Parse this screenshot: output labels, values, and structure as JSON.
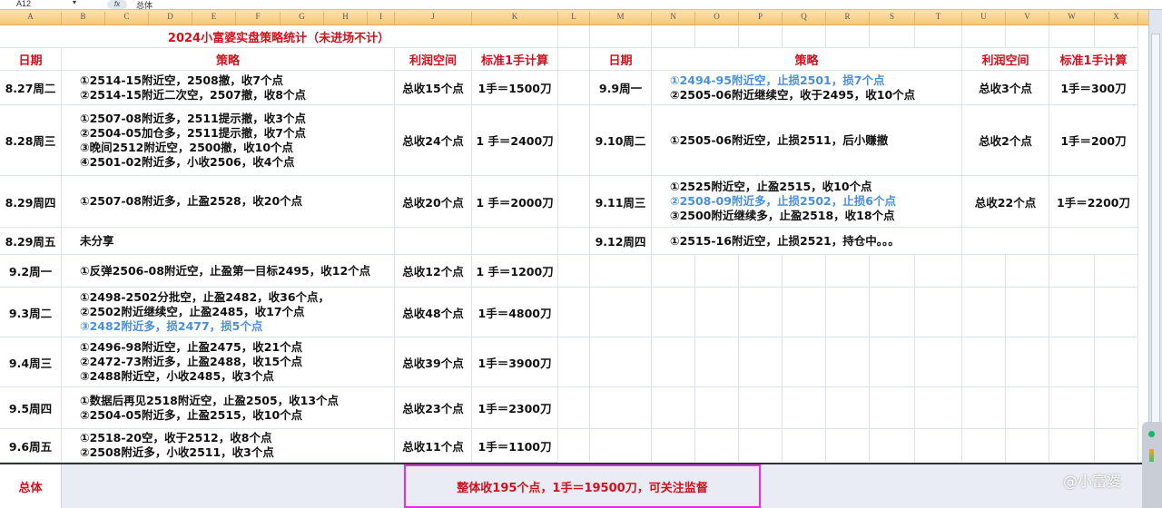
{
  "formula_bar": {
    "name_box": "A12",
    "fx": "fx",
    "value": "总体"
  },
  "columns": [
    "A",
    "B",
    "C",
    "D",
    "E",
    "F",
    "G",
    "H",
    "I",
    "J",
    "K",
    "L",
    "M",
    "N",
    "O",
    "P",
    "Q",
    "R",
    "S",
    "T",
    "U",
    "V",
    "W",
    "X"
  ],
  "title": "2024小富婆实盘策略统计（未进场不计）",
  "headers": {
    "date": "日期",
    "strategy": "策略",
    "profit": "利润空间",
    "calc": "标准1手计算"
  },
  "left_rows": [
    {
      "date": "8.27周二",
      "lines": [
        {
          "text": "①2514-15附近空，2508撤，收7个点"
        },
        {
          "text": "②2514-15附近二次空，2507撤，收8个点"
        }
      ],
      "profit": "总收15个点",
      "calc": "1手＝1500刀"
    },
    {
      "date": "8.28周三",
      "lines": [
        {
          "text": "①2507-08附近多，2511提示撤，收3个点"
        },
        {
          "text": "②2504-05加仓多，2511提示撤，收7个点"
        },
        {
          "text": "③晚间2512附近空，2500撤，收10个点"
        },
        {
          "text": "④2501-02附近多，小收2506，收4个点"
        }
      ],
      "profit": "总收24个点",
      "calc": "1 手＝2400刀"
    },
    {
      "date": "8.29周四",
      "lines": [
        {
          "text": "①2507-08附近多，止盈2528，收20个点"
        }
      ],
      "profit": "总收20个点",
      "calc": "1 手＝2000刀"
    },
    {
      "date": "8.29周五",
      "lines": [
        {
          "text": "未分享"
        }
      ],
      "profit": "",
      "calc": ""
    },
    {
      "date": "9.2周一",
      "lines": [
        {
          "text": "①反弹2506-08附近空，止盈第一目标2495，收12个点"
        }
      ],
      "profit": "总收12个点",
      "calc": "1 手＝1200刀"
    },
    {
      "date": "9.3周二",
      "lines": [
        {
          "text": "①2498-2502分批空，止盈2482，收36个点，"
        },
        {
          "text": "②2502附近继续空，止盈2485，收17个点"
        },
        {
          "text": "③2482附近多，损2477，损5个点",
          "loss": true
        }
      ],
      "profit": "总收48个点",
      "calc": "1手＝4800刀"
    },
    {
      "date": "9.4周三",
      "lines": [
        {
          "text": "①2496-98附近空，止盈2475，收21个点"
        },
        {
          "text": "②2472-73附近多，止盈2488，收15个点"
        },
        {
          "text": "③2488附近空，小收2485，收3个点"
        }
      ],
      "profit": "总收39个点",
      "calc": "1手＝3900刀"
    },
    {
      "date": "9.5周四",
      "lines": [
        {
          "text": "①数据后再见2518附近空，止盈2505，收13个点"
        },
        {
          "text": "②2504-05附近多，止盈2515，收10个点"
        }
      ],
      "profit": "总收23个点",
      "calc": "1手＝2300刀"
    },
    {
      "date": "9.6周五",
      "lines": [
        {
          "text": "①2518-20空，收于2512，收8个点"
        },
        {
          "text": "②2508附近多，小收2511，收3个点"
        }
      ],
      "profit": "总收11个点",
      "calc": "1手＝1100刀"
    }
  ],
  "right_rows": [
    {
      "date": "9.9周一",
      "lines": [
        {
          "text": "①2494-95附近空，止损2501，损7个点",
          "loss": true
        },
        {
          "text": "②2505-06附近继续空，收于2495，收10个点"
        }
      ],
      "profit": "总收3个点",
      "calc": "1手＝300刀"
    },
    {
      "date": "9.10周二",
      "lines": [
        {
          "text": "①2505-06附近空，止损2511，后小赚撤"
        }
      ],
      "profit": "总收2个点",
      "calc": "1手＝200刀"
    },
    {
      "date": "9.11周三",
      "lines": [
        {
          "text": "①2525附近空，止盈2515，收10个点"
        },
        {
          "text": "②2508-09附近多，止损2502，止损6个点",
          "loss": true
        },
        {
          "text": "③2500附近继续多，止盈2518，收18个点"
        }
      ],
      "profit": "总收22个点",
      "calc": "1手＝2200刀"
    },
    {
      "date": "9.12周四",
      "lines": [
        {
          "text": "①2515-16附近空，止损2521，持仓中。。。"
        }
      ],
      "profit": "",
      "calc": ""
    }
  ],
  "total": {
    "label": "总体",
    "summary": "整体收195个点，1手＝19500刀，可关注监督"
  },
  "watermark": "@小富婆",
  "colors": {
    "header_red": "#d0101c",
    "loss_blue": "#4a8fd8",
    "highlight_border": "#e62ee6"
  }
}
